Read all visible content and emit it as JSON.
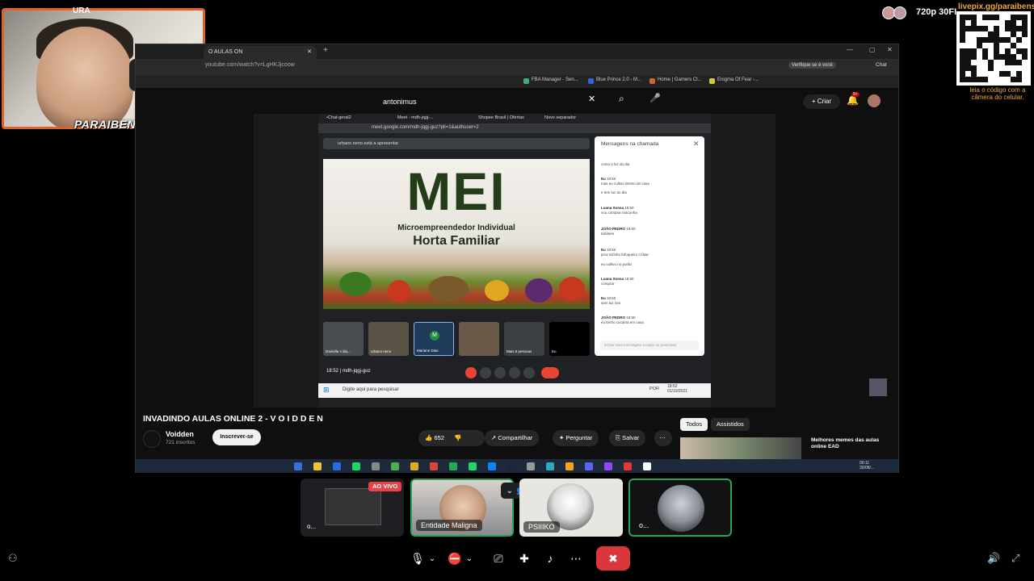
{
  "overlay": {
    "streamer_name": "PARAIBENSE",
    "cam_top_label": "URA",
    "stream_quality": "720p 30FI",
    "livepix_url": "livepix.gg/paraibense",
    "livepix_note": "leia o código com a câmera do celular."
  },
  "browser": {
    "tab_title": "O AULAS ON",
    "url": "youtube.com/watch?v=LgHKJjcoow",
    "bookmarks": [
      "FBA Manager - Sen...",
      "Blue Prince 2.0 - M...",
      "Home | Gamers Cl...",
      "Enigma Of Fear -..."
    ],
    "verify_label": "Verifique se é você",
    "chat_label": "Chat"
  },
  "youtube": {
    "search_value": "antonimus",
    "create_label": "Criar",
    "notif_count": "9+",
    "video_title": "INVADINDO AULAS ONLINE 2 - V O I D D E N",
    "channel_name": "Voidden",
    "channel_subs": "721 inscritos",
    "subscribe_label": "Inscrever-se",
    "like_count": "652",
    "share_label": "Compartilhar",
    "ask_label": "Perguntar",
    "save_label": "Salvar",
    "chip_all": "Todos",
    "chip_watched": "Assistidos",
    "rec_title": "Melhores memes das aulas online EAD"
  },
  "meet": {
    "tabs": [
      "•Chat-geral2",
      "Meet - mdh-jqgj-...",
      "Shopee Brasil | Ofertas",
      "Novo separador"
    ],
    "url": "meet.google.com/mdh-jqgj-guz?pli=1&authuser=2",
    "presenter": "urbano neno está a apresentar",
    "slide_title": "MEI",
    "slide_sub1": "Microempreendedor Individual",
    "slide_sub2": "Horta Familiar",
    "chat_title": "Mensagens na chamada",
    "chat_messages": [
      {
        "author": "",
        "time": "",
        "text": "como a luz do dia"
      },
      {
        "author": "Eu",
        "time": "18:50",
        "text": "mas eu cultivo dentro de casa"
      },
      {
        "author": "",
        "time": "",
        "text": "e tem luz do dia"
      },
      {
        "author": "Luana Sonsa",
        "time": "18:50",
        "text": "vou comprar maconha"
      },
      {
        "author": "JOÃO PEDRO",
        "time": "18:50",
        "text": "tambem"
      },
      {
        "author": "Eu",
        "time": "18:50",
        "text": "prov vizinho fofoqueiro n falar"
      },
      {
        "author": "",
        "time": "",
        "text": "eu cultivo no porão"
      },
      {
        "author": "Luana Sonsa",
        "time": "18:50",
        "text": "comprar"
      },
      {
        "author": "Eu",
        "time": "18:50",
        "text": "sem luz rsrs"
      },
      {
        "author": "JOÃO PEDRO",
        "time": "18:50",
        "text": "eu tenho cocaína em casa"
      }
    ],
    "chat_placeholder": "Enviar uma mensagem a todos os presentes",
    "win_activate": "Ativar o Windows",
    "participants": [
      "Danielle s dia...",
      "urbano neno",
      "Mariane Dias",
      "",
      "Mais 6 pessoas",
      "Eu"
    ],
    "tile_letter": "M",
    "meet_time": "18:52",
    "meet_code": "mdh-jqgj-guz",
    "taskbar_search": "Digite aqui para pesquisar",
    "taskbar_lang": "POR",
    "taskbar_time": "18:52",
    "taskbar_date": "01/10/2021"
  },
  "host": {
    "clock_time": "00:11",
    "clock_date": "30/08/..."
  },
  "discord": {
    "participants": [
      {
        "label": "o...",
        "live": "AO VIVO"
      },
      {
        "label": "Entidade Maligna"
      },
      {
        "label": "PSIIIKO"
      },
      {
        "label": "o..."
      }
    ]
  },
  "colors": {
    "accent_orange": "#e0622b",
    "discord_green": "#23a55a",
    "discord_red": "#da373c",
    "live_red": "#ed4245",
    "slide_green": "#243d19"
  }
}
